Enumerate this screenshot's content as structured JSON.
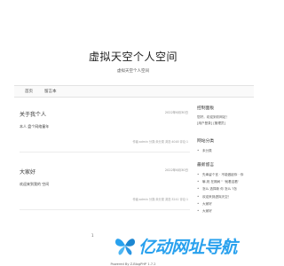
{
  "header": {
    "title": "虚拟天空个人空间",
    "subtitle": "虚拟天空个人空间"
  },
  "nav": {
    "items": [
      {
        "label": "首页"
      },
      {
        "label": "留言本"
      }
    ]
  },
  "posts": [
    {
      "title": "关于我个人",
      "date": "2022年6月30日",
      "excerpt": "本人 盘个网络童年",
      "meta": "作者:admin  分类:未分类  浏览:4048  评论:1"
    },
    {
      "title": "大家好",
      "date": "2022年6月30日",
      "excerpt": "欢迎来到我的 空间",
      "meta": "作者:admin  分类:未分类  浏览:3241  评论:1"
    }
  ],
  "sidebar": {
    "control_panel": {
      "title": "控制面板",
      "lines": [
        "您好，欢迎到访网站！",
        "[用户登录]  [管理员]"
      ]
    },
    "categories": {
      "title": "网站分类",
      "items": [
        "未分类"
      ]
    },
    "recent_comments": {
      "title": "最新留言",
      "items": [
        "先辈留个言 · 不能做起你 · 你",
        "嘛,祝 在期间 '' '就着这看'",
        "怎么 选择新 你 怎么 ?怎",
        "欢迎来到虚拟天空！",
        "大家好",
        "大家好"
      ]
    }
  },
  "pager": {
    "label": "1"
  },
  "footer": {
    "text": "Powered By Z-BlogPHP 1.7.2"
  },
  "watermark": {
    "text": "亿动网址导航",
    "color": "#29a1ee",
    "icon": "butterfly-logo-icon"
  }
}
